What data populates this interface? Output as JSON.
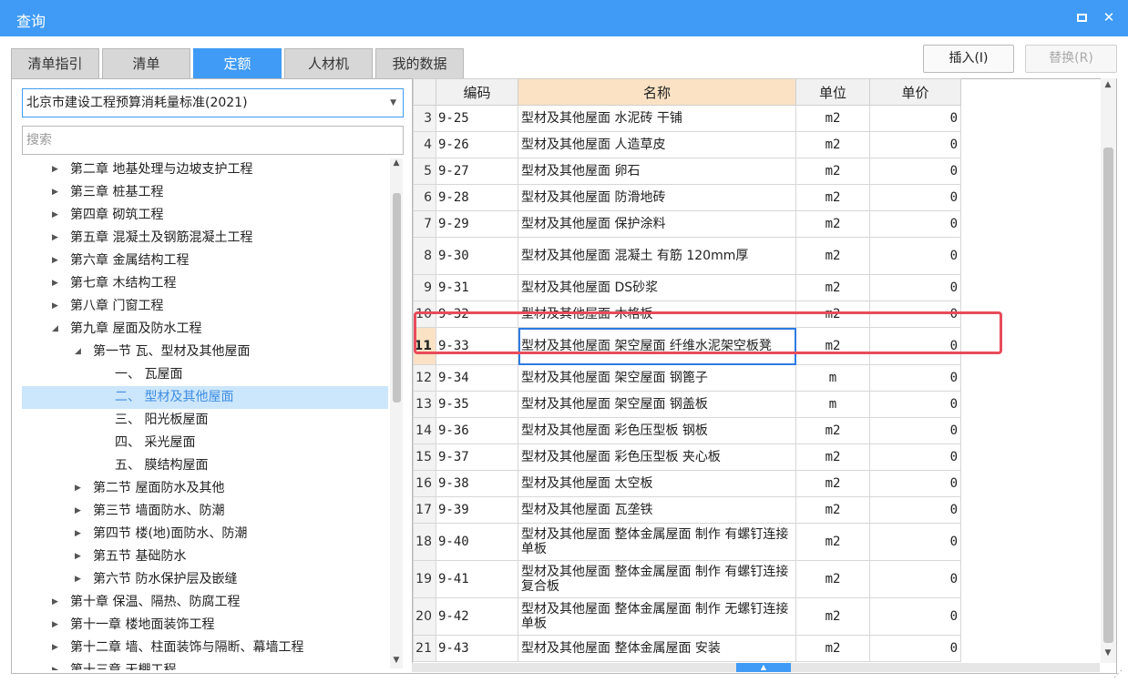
{
  "window": {
    "title": "查询",
    "maximize_label": "□",
    "close_label": "✕"
  },
  "tabs": [
    "清单指引",
    "清单",
    "定额",
    "人材机",
    "我的数据"
  ],
  "active_tab": "定额",
  "buttons": {
    "insert": "插入(I)",
    "replace": "替换(R)"
  },
  "left": {
    "standard": "北京市建设工程预算消耗量标准(2021)",
    "search_placeholder": "搜索",
    "tree": [
      {
        "label": "第二章 地基处理与边坡支护工程",
        "level": 0,
        "expand": "collapsed"
      },
      {
        "label": "第三章 桩基工程",
        "level": 0,
        "expand": "collapsed"
      },
      {
        "label": "第四章 砌筑工程",
        "level": 0,
        "expand": "collapsed"
      },
      {
        "label": "第五章 混凝土及钢筋混凝土工程",
        "level": 0,
        "expand": "collapsed"
      },
      {
        "label": "第六章 金属结构工程",
        "level": 0,
        "expand": "collapsed"
      },
      {
        "label": "第七章 木结构工程",
        "level": 0,
        "expand": "collapsed"
      },
      {
        "label": "第八章 门窗工程",
        "level": 0,
        "expand": "collapsed"
      },
      {
        "label": "第九章 屋面及防水工程",
        "level": 0,
        "expand": "expanded"
      },
      {
        "label": "第一节 瓦、型材及其他屋面",
        "level": 1,
        "expand": "expanded"
      },
      {
        "label": "一、 瓦屋面",
        "level": 2,
        "expand": "none"
      },
      {
        "label": "二、 型材及其他屋面",
        "level": 2,
        "expand": "none",
        "selected": true
      },
      {
        "label": "三、 阳光板屋面",
        "level": 2,
        "expand": "none"
      },
      {
        "label": "四、 采光屋面",
        "level": 2,
        "expand": "none"
      },
      {
        "label": "五、 膜结构屋面",
        "level": 2,
        "expand": "none"
      },
      {
        "label": "第二节 屋面防水及其他",
        "level": 1,
        "expand": "collapsed"
      },
      {
        "label": "第三节 墙面防水、防潮",
        "level": 1,
        "expand": "collapsed"
      },
      {
        "label": "第四节 楼(地)面防水、防潮",
        "level": 1,
        "expand": "collapsed"
      },
      {
        "label": "第五节 基础防水",
        "level": 1,
        "expand": "collapsed"
      },
      {
        "label": "第六节 防水保护层及嵌缝",
        "level": 1,
        "expand": "collapsed"
      },
      {
        "label": "第十章 保温、隔热、防腐工程",
        "level": 0,
        "expand": "collapsed"
      },
      {
        "label": "第十一章 楼地面装饰工程",
        "level": 0,
        "expand": "collapsed"
      },
      {
        "label": "第十二章 墙、柱面装饰与隔断、幕墙工程",
        "level": 0,
        "expand": "collapsed"
      },
      {
        "label": "第十三章 天棚工程",
        "level": 0,
        "expand": "collapsed"
      }
    ]
  },
  "grid": {
    "headers": [
      "",
      "编码",
      "名称",
      "单位",
      "单价"
    ],
    "current_row": 11,
    "rows": [
      {
        "idx": "3",
        "code": "9-25",
        "name": "型材及其他屋面 水泥砖 干铺",
        "unit": "m2",
        "price": "0"
      },
      {
        "idx": "4",
        "code": "9-26",
        "name": "型材及其他屋面 人造草皮",
        "unit": "m2",
        "price": "0"
      },
      {
        "idx": "5",
        "code": "9-27",
        "name": "型材及其他屋面 卵石",
        "unit": "m2",
        "price": "0"
      },
      {
        "idx": "6",
        "code": "9-28",
        "name": "型材及其他屋面 防滑地砖",
        "unit": "m2",
        "price": "0"
      },
      {
        "idx": "7",
        "code": "9-29",
        "name": "型材及其他屋面 保护涂料",
        "unit": "m2",
        "price": "0"
      },
      {
        "idx": "8",
        "code": "9-30",
        "name": "型材及其他屋面 混凝土 有筋 120mm厚",
        "unit": "m2",
        "price": "0"
      },
      {
        "idx": "9",
        "code": "9-31",
        "name": "型材及其他屋面 DS砂浆",
        "unit": "m2",
        "price": "0"
      },
      {
        "idx": "10",
        "code": "9-32",
        "name": "型材及其他屋面 木格板",
        "unit": "m2",
        "price": "0"
      },
      {
        "idx": "11",
        "code": "9-33",
        "name": "型材及其他屋面 架空屋面 纤维水泥架空板凳",
        "unit": "m2",
        "price": "0"
      },
      {
        "idx": "12",
        "code": "9-34",
        "name": "型材及其他屋面 架空屋面 钢篦子",
        "unit": "m",
        "price": "0"
      },
      {
        "idx": "13",
        "code": "9-35",
        "name": "型材及其他屋面 架空屋面 钢盖板",
        "unit": "m",
        "price": "0"
      },
      {
        "idx": "14",
        "code": "9-36",
        "name": "型材及其他屋面 彩色压型板 钢板",
        "unit": "m2",
        "price": "0"
      },
      {
        "idx": "15",
        "code": "9-37",
        "name": "型材及其他屋面 彩色压型板 夹心板",
        "unit": "m2",
        "price": "0"
      },
      {
        "idx": "16",
        "code": "9-38",
        "name": "型材及其他屋面 太空板",
        "unit": "m2",
        "price": "0"
      },
      {
        "idx": "17",
        "code": "9-39",
        "name": "型材及其他屋面 瓦垄铁",
        "unit": "m2",
        "price": "0"
      },
      {
        "idx": "18",
        "code": "9-40",
        "name": "型材及其他屋面 整体金属屋面 制作 有螺钉连接 单板",
        "unit": "m2",
        "price": "0"
      },
      {
        "idx": "19",
        "code": "9-41",
        "name": "型材及其他屋面 整体金属屋面 制作 有螺钉连接 复合板",
        "unit": "m2",
        "price": "0"
      },
      {
        "idx": "20",
        "code": "9-42",
        "name": "型材及其他屋面 整体金属屋面 制作 无螺钉连接 单板",
        "unit": "m2",
        "price": "0"
      },
      {
        "idx": "21",
        "code": "9-43",
        "name": "型材及其他屋面 整体金属屋面 安装",
        "unit": "m2",
        "price": "0"
      }
    ]
  },
  "colors": {
    "accent": "#3f9bf5",
    "highlight": "#e84b5a",
    "header_name": "#fbe2c4"
  }
}
